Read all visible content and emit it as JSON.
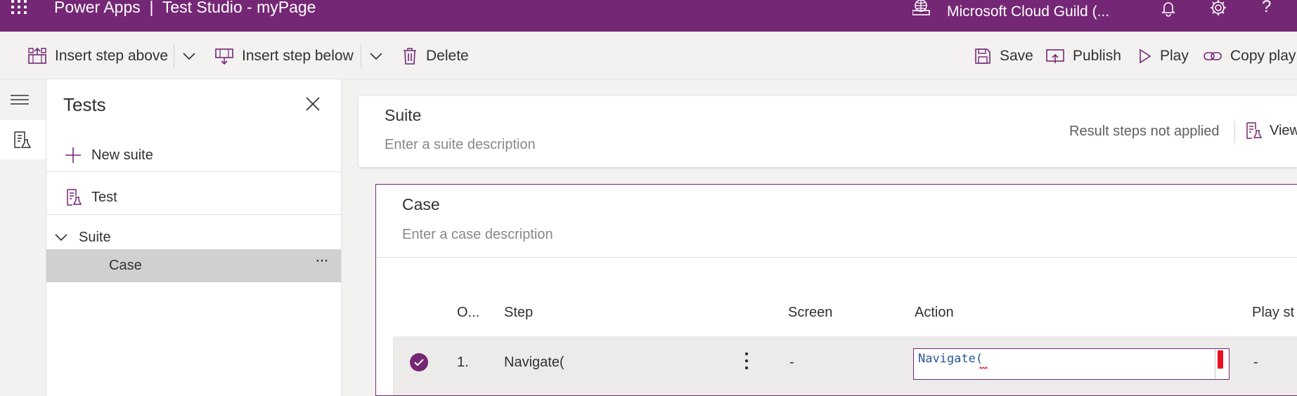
{
  "app": {
    "brand": "Power Apps  |  Test Studio - myPage",
    "environment": "Microsoft Cloud Guild (...",
    "help_label": "?"
  },
  "commands": {
    "insert_above": "Insert step above",
    "insert_below": "Insert step below",
    "delete": "Delete",
    "save": "Save",
    "publish": "Publish",
    "play": "Play",
    "copy_play": "Copy play"
  },
  "tests_panel": {
    "title": "Tests",
    "new_suite": "New suite",
    "test": "Test",
    "suite": "Suite",
    "case": "Case",
    "more": "···"
  },
  "suite_card": {
    "title": "Suite",
    "description_placeholder": "Enter a suite description",
    "result_note": "Result steps not applied",
    "view": "View"
  },
  "case_card": {
    "title": "Case",
    "description_placeholder": "Enter a case description",
    "columns": [
      "O...",
      "Step",
      "Screen",
      "Action",
      "Play st"
    ],
    "rows": [
      {
        "order": "1.",
        "step": "Navigate(",
        "screen": "-",
        "action": "Navigate(",
        "play_status": "-"
      }
    ]
  },
  "colors": {
    "accent": "#742774",
    "command_bg": "#f3f2f1",
    "selected_row": "#edebe9",
    "code_text": "#2b5797",
    "error_mark": "#e81123"
  }
}
